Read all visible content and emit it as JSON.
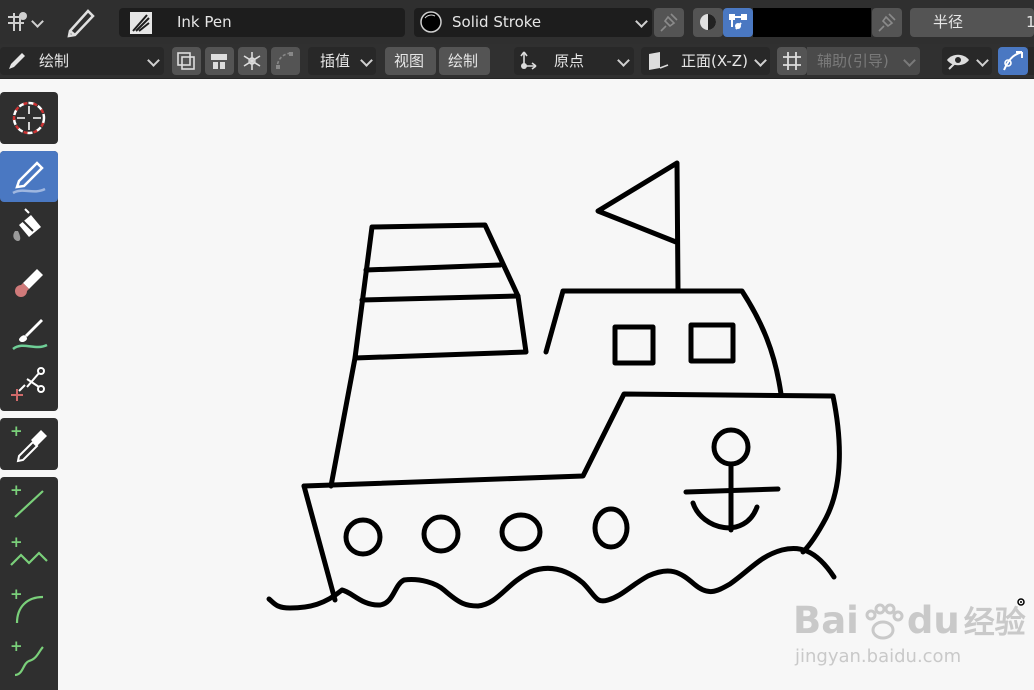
{
  "header": {
    "brush_name": "Ink Pen",
    "stroke_material": "Solid Stroke",
    "color_swatch": "#000000",
    "radius_label": "半径",
    "radius_value": "1"
  },
  "subbar": {
    "mode": "绘制",
    "interpolate": "插值",
    "view_btn": "视图",
    "draw_btn": "绘制",
    "origin": "原点",
    "plane": "正面(X-Z)",
    "guides": "辅助(引导)"
  },
  "toolbar": {
    "items": [
      {
        "name": "cursor",
        "icon": "cursor-icon"
      },
      {
        "name": "draw",
        "icon": "pencil-icon",
        "active": true
      },
      {
        "name": "fill",
        "icon": "fill-bucket-icon"
      },
      {
        "name": "erase",
        "icon": "eraser-icon"
      },
      {
        "name": "tint",
        "icon": "tint-brush-icon"
      },
      {
        "name": "cutter",
        "icon": "scissors-icon"
      },
      {
        "name": "eyedropper",
        "icon": "eyedropper-icon"
      },
      {
        "name": "line",
        "icon": "line-icon"
      },
      {
        "name": "polyline",
        "icon": "polyline-icon"
      },
      {
        "name": "arc",
        "icon": "arc-icon"
      },
      {
        "name": "curve",
        "icon": "curve-icon"
      }
    ]
  },
  "colors": {
    "accent": "#4a78c2",
    "canvas": "#f7f7f7",
    "header_bg": "#2f2f2f",
    "stroke": "#000000"
  },
  "watermark": {
    "brand_latin": "Bai",
    "brand_du": "du",
    "brand_cn": "经验",
    "url": "jingyan.baidu.com"
  }
}
